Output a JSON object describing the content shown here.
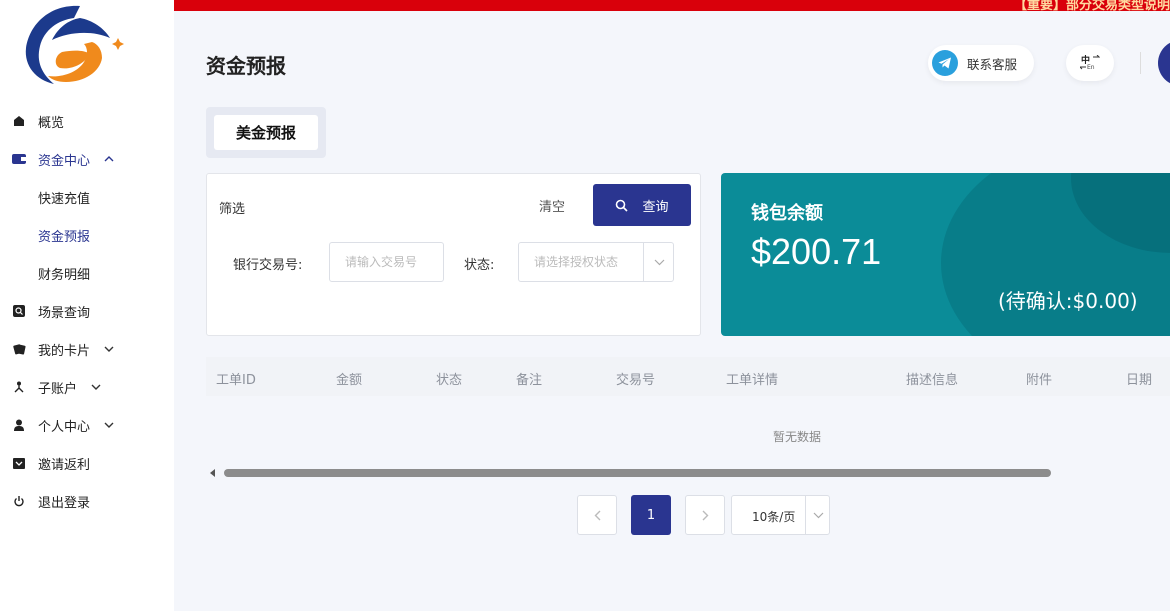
{
  "sidebar": {
    "items": [
      {
        "label": "概览",
        "icon": "home-icon"
      },
      {
        "label": "资金中心",
        "icon": "wallet-icon"
      },
      {
        "label": "快速充值"
      },
      {
        "label": "资金预报"
      },
      {
        "label": "财务明细"
      },
      {
        "label": "场景查询",
        "icon": "search-box-icon"
      },
      {
        "label": "我的卡片",
        "icon": "cards-icon"
      },
      {
        "label": "子账户",
        "icon": "sub-account-icon"
      },
      {
        "label": "个人中心",
        "icon": "user-icon"
      },
      {
        "label": "邀请返利",
        "icon": "gift-icon"
      },
      {
        "label": "退出登录",
        "icon": "power-icon"
      }
    ]
  },
  "banner": {
    "text": "【重要】部分交易类型说明"
  },
  "header": {
    "title": "资金预报",
    "contact_label": "联系客服",
    "lang_zh": "中",
    "lang_en": "En"
  },
  "tabs": [
    {
      "label": "美金预报"
    }
  ],
  "filter": {
    "label": "筛选",
    "clear_label": "清空",
    "query_label": "查询",
    "bank_tx_label": "银行交易号:",
    "bank_tx_placeholder": "请输入交易号",
    "status_label": "状态:",
    "status_placeholder": "请选择授权状态"
  },
  "wallet": {
    "title": "钱包余额",
    "amount": "$200.71",
    "pending": "(待确认:$0.00)"
  },
  "table": {
    "columns": [
      "工单ID",
      "金额",
      "状态",
      "备注",
      "交易号",
      "工单详情",
      "描述信息",
      "附件",
      "日期"
    ],
    "empty_text": "暂无数据"
  },
  "pagination": {
    "current_page": "1",
    "page_size": "10条/页"
  },
  "colors": {
    "accent": "#2a3590",
    "wallet_bg": "#0b8c98",
    "banner_bg": "#d9000b"
  }
}
